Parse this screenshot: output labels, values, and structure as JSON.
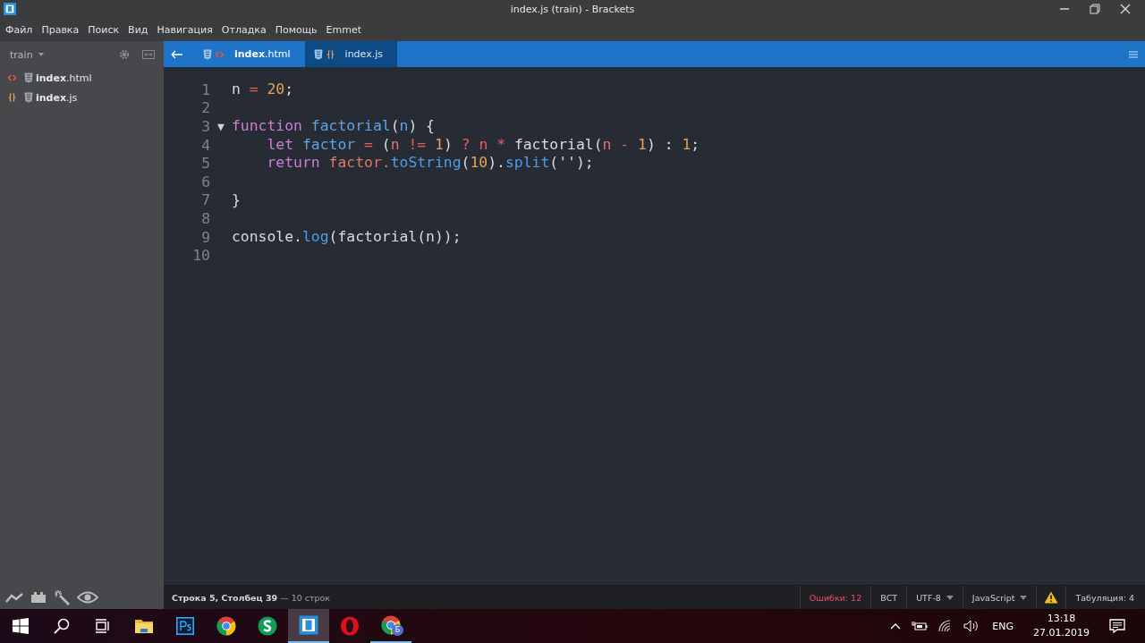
{
  "window": {
    "title": "index.js (train) - Brackets"
  },
  "menu": [
    "Файл",
    "Правка",
    "Поиск",
    "Вид",
    "Навигация",
    "Отладка",
    "Помощь",
    "Emmet"
  ],
  "sidebar": {
    "project": "train",
    "files": [
      {
        "name": "**index**.html",
        "kind": "html"
      },
      {
        "name": "**index**.js",
        "kind": "js"
      }
    ]
  },
  "tabs": [
    {
      "label": "**index**.html",
      "kind": "html",
      "selected": false
    },
    {
      "label": "index.js",
      "kind": "js",
      "selected": true
    }
  ],
  "code": [
    {
      "number": "1",
      "tokens": [
        {
          "t": "n ",
          "color": "#d7dae0"
        },
        {
          "t": "= ",
          "color": "#e0605e"
        },
        {
          "t": "20",
          "color": "#e5a05a"
        },
        {
          "t": ";",
          "color": "#d7dae0"
        }
      ]
    },
    {
      "number": "2"
    },
    {
      "number": "3",
      "fold": "▼",
      "tokens": [
        {
          "t": "function ",
          "color": "#c97fd6"
        },
        {
          "t": "factorial",
          "color": "#5ca4e8"
        },
        {
          "t": "(",
          "color": "#d7dae0"
        },
        {
          "t": "n",
          "color": "#5ca4e8"
        },
        {
          "t": ") {",
          "color": "#d7dae0"
        }
      ]
    },
    {
      "number": "4",
      "tokens": [
        {
          "t": "    let ",
          "color": "#c97fd6"
        },
        {
          "t": "factor ",
          "color": "#5ca4e8"
        },
        {
          "t": "= ",
          "color": "#e0605e"
        },
        {
          "t": "(",
          "color": "#d7dae0"
        },
        {
          "t": "n ",
          "color": "#e37666"
        },
        {
          "t": "!= ",
          "color": "#e0605e"
        },
        {
          "t": "1",
          "color": "#e5a05a"
        },
        {
          "t": ") ",
          "color": "#d7dae0"
        },
        {
          "t": "? ",
          "color": "#e0605e"
        },
        {
          "t": "n * ",
          "color": "#e0605e"
        },
        {
          "t": "factorial(",
          "color": "#d7dae0"
        },
        {
          "t": "n ",
          "color": "#e37666"
        },
        {
          "t": "- ",
          "color": "#e0605e"
        },
        {
          "t": "1",
          "color": "#e5a05a"
        },
        {
          "t": ") : ",
          "color": "#d7dae0"
        },
        {
          "t": "1",
          "color": "#e5a05a"
        },
        {
          "t": ";",
          "color": "#d7dae0"
        }
      ]
    },
    {
      "number": "5",
      "tokens": [
        {
          "t": "    return ",
          "color": "#c97fd6"
        },
        {
          "t": "factor.",
          "color": "#e37666"
        },
        {
          "t": "toString",
          "color": "#4c9df0"
        },
        {
          "t": "(",
          "color": "#d7dae0"
        },
        {
          "t": "10",
          "color": "#e5a05a"
        },
        {
          "t": ").",
          "color": "#d7dae0"
        },
        {
          "t": "split",
          "color": "#4c9df0"
        },
        {
          "t": "('');",
          "color": "#d7dae0"
        }
      ]
    },
    {
      "number": "6"
    },
    {
      "number": "7",
      "tokens": [
        {
          "t": "}",
          "color": "#d7dae0"
        }
      ]
    },
    {
      "number": "8"
    },
    {
      "number": "9",
      "tokens": [
        {
          "t": "console.",
          "color": "#d7dae0"
        },
        {
          "t": "log",
          "color": "#4c9df0"
        },
        {
          "t": "(factorial(n));",
          "color": "#d7dae0"
        }
      ]
    },
    {
      "number": "10"
    }
  ],
  "status_bar": {
    "position": "**Строка 5, Столбец 39** — 10 строк",
    "errors": "Ошибки: 12",
    "mode": "ВСТ",
    "encoding": "UTF-8",
    "language": "JavaScript",
    "indent": "Табуляция: 4"
  },
  "taskbar": {
    "apps": [
      {
        "kind": "start",
        "active": false,
        "running": false
      },
      {
        "kind": "search",
        "active": false,
        "running": false
      },
      {
        "kind": "taskview",
        "active": false,
        "running": false
      },
      {
        "kind": "folder",
        "active": false,
        "running": false
      },
      {
        "kind": "ps",
        "active": false,
        "running": false
      },
      {
        "kind": "chrome",
        "active": false,
        "running": false
      },
      {
        "kind": "s",
        "active": false,
        "running": false
      },
      {
        "kind": "brackets",
        "active": true,
        "running": true
      },
      {
        "kind": "opera",
        "active": false,
        "running": false
      },
      {
        "kind": "chrome",
        "active": false,
        "running": true,
        "badge": "Б"
      }
    ],
    "language": "ENG",
    "time": "13:18",
    "date": "27.01.2019"
  }
}
